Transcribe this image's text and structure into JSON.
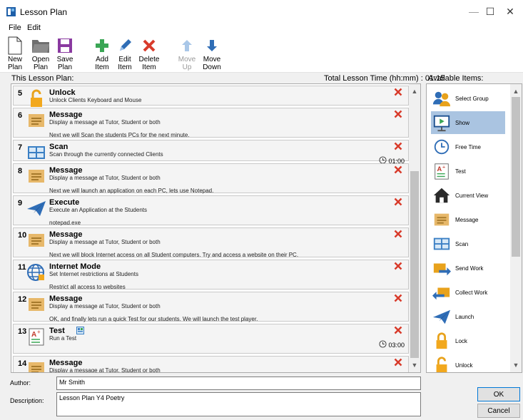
{
  "window": {
    "title": "Lesson Plan",
    "minimize": "—",
    "maximize": "☐",
    "close": "✕"
  },
  "menu": {
    "file": "File",
    "edit": "Edit"
  },
  "toolbar": {
    "new": "New\nPlan",
    "open": "Open\nPlan",
    "save": "Save\nPlan",
    "add": "Add\nItem",
    "edit": "Edit\nItem",
    "delete": "Delete\nItem",
    "move_up": "Move\nUp",
    "move_down": "Move\nDown"
  },
  "labels": {
    "this_plan": "This Lesson Plan:",
    "total_time": "Total Lesson Time (hh:mm) : 01:15",
    "available": "Available Items:",
    "author": "Author:",
    "description": "Description:"
  },
  "plan_items": [
    {
      "num": "5",
      "icon": "unlock-icon",
      "title": "Unlock",
      "desc": "Unlock Clients Keyboard and Mouse",
      "note": "",
      "time": ""
    },
    {
      "num": "6",
      "icon": "message-icon",
      "title": "Message",
      "desc": "Display a message at Tutor, Student or both",
      "note": "Next we will Scan the students PCs for the next minute.",
      "time": ""
    },
    {
      "num": "7",
      "icon": "scan-icon",
      "title": "Scan",
      "desc": "Scan through the currently connected Clients",
      "note": "",
      "time": "01:00"
    },
    {
      "num": "8",
      "icon": "message-icon",
      "title": "Message",
      "desc": "Display a message at Tutor, Student or both",
      "note": "Next we will launch an application on each PC, lets use Notepad.",
      "time": ""
    },
    {
      "num": "9",
      "icon": "launch-icon",
      "title": "Execute",
      "desc": "Execute an Application at the Students",
      "note": "notepad.exe",
      "time": ""
    },
    {
      "num": "10",
      "icon": "message-icon",
      "title": "Message",
      "desc": "Display a message at Tutor, Student or both",
      "note": "Next we will block Internet access on all Student computers. Try and access a website on their PC.",
      "time": ""
    },
    {
      "num": "11",
      "icon": "internet-icon",
      "title": "Internet Mode",
      "desc": "Set Internet restrictions at Students",
      "note": "Restrict all access to websites",
      "time": ""
    },
    {
      "num": "12",
      "icon": "message-icon",
      "title": "Message",
      "desc": "Display a message at Tutor, Student or both",
      "note": "OK, and finally lets run a quick Test for our students. We will launch the test player.",
      "time": ""
    },
    {
      "num": "13",
      "icon": "test-icon",
      "title": "Test",
      "desc": "Run a Test",
      "note": "",
      "time": "03:00"
    },
    {
      "num": "14",
      "icon": "message-icon",
      "title": "Message",
      "desc": "Display a message at Tutor, Student or both",
      "note": "",
      "time": ""
    }
  ],
  "available_items": [
    {
      "label": "Select Group",
      "icon": "select-group-icon"
    },
    {
      "label": "Show",
      "icon": "show-icon"
    },
    {
      "label": "Free Time",
      "icon": "clock-icon"
    },
    {
      "label": "Test",
      "icon": "test-icon"
    },
    {
      "label": "Current View",
      "icon": "house-icon"
    },
    {
      "label": "Message",
      "icon": "message-icon"
    },
    {
      "label": "Scan",
      "icon": "scan-icon"
    },
    {
      "label": "Send Work",
      "icon": "send-work-icon"
    },
    {
      "label": "Collect Work",
      "icon": "collect-work-icon"
    },
    {
      "label": "Launch",
      "icon": "launch-icon"
    },
    {
      "label": "Lock",
      "icon": "lock-icon"
    },
    {
      "label": "Unlock",
      "icon": "unlock-icon"
    }
  ],
  "form": {
    "author": "Mr Smith",
    "description": "Lesson Plan Y4 Poetry"
  },
  "buttons": {
    "ok": "OK",
    "cancel": "Cancel"
  },
  "colors": {
    "accent": "#0078d7",
    "delete_red": "#d83b2b",
    "add_green": "#3aa655",
    "folder": "#7a7a7a",
    "save_purple": "#8a3aa0",
    "selected": "#aac4e1"
  }
}
